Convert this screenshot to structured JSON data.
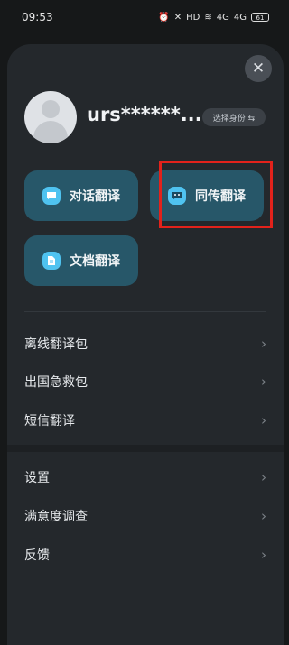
{
  "status_bar": {
    "time": "09:53",
    "signal_1": "4G",
    "signal_2": "4G",
    "hd": "HD",
    "battery": "61"
  },
  "panel": {
    "username": "urs******...",
    "identity_button": "选择身份 ⇆",
    "cards": [
      {
        "label": "对话翻译",
        "icon": "chat-bubble-icon"
      },
      {
        "label": "同传翻译",
        "icon": "simultaneous-interpret-icon"
      },
      {
        "label": "文档翻译",
        "icon": "document-icon"
      }
    ],
    "menu_group_1": [
      {
        "label": "离线翻译包"
      },
      {
        "label": "出国急救包"
      },
      {
        "label": "短信翻译"
      }
    ],
    "menu_group_2": [
      {
        "label": "设置"
      },
      {
        "label": "满意度调查"
      },
      {
        "label": "反馈"
      }
    ]
  }
}
